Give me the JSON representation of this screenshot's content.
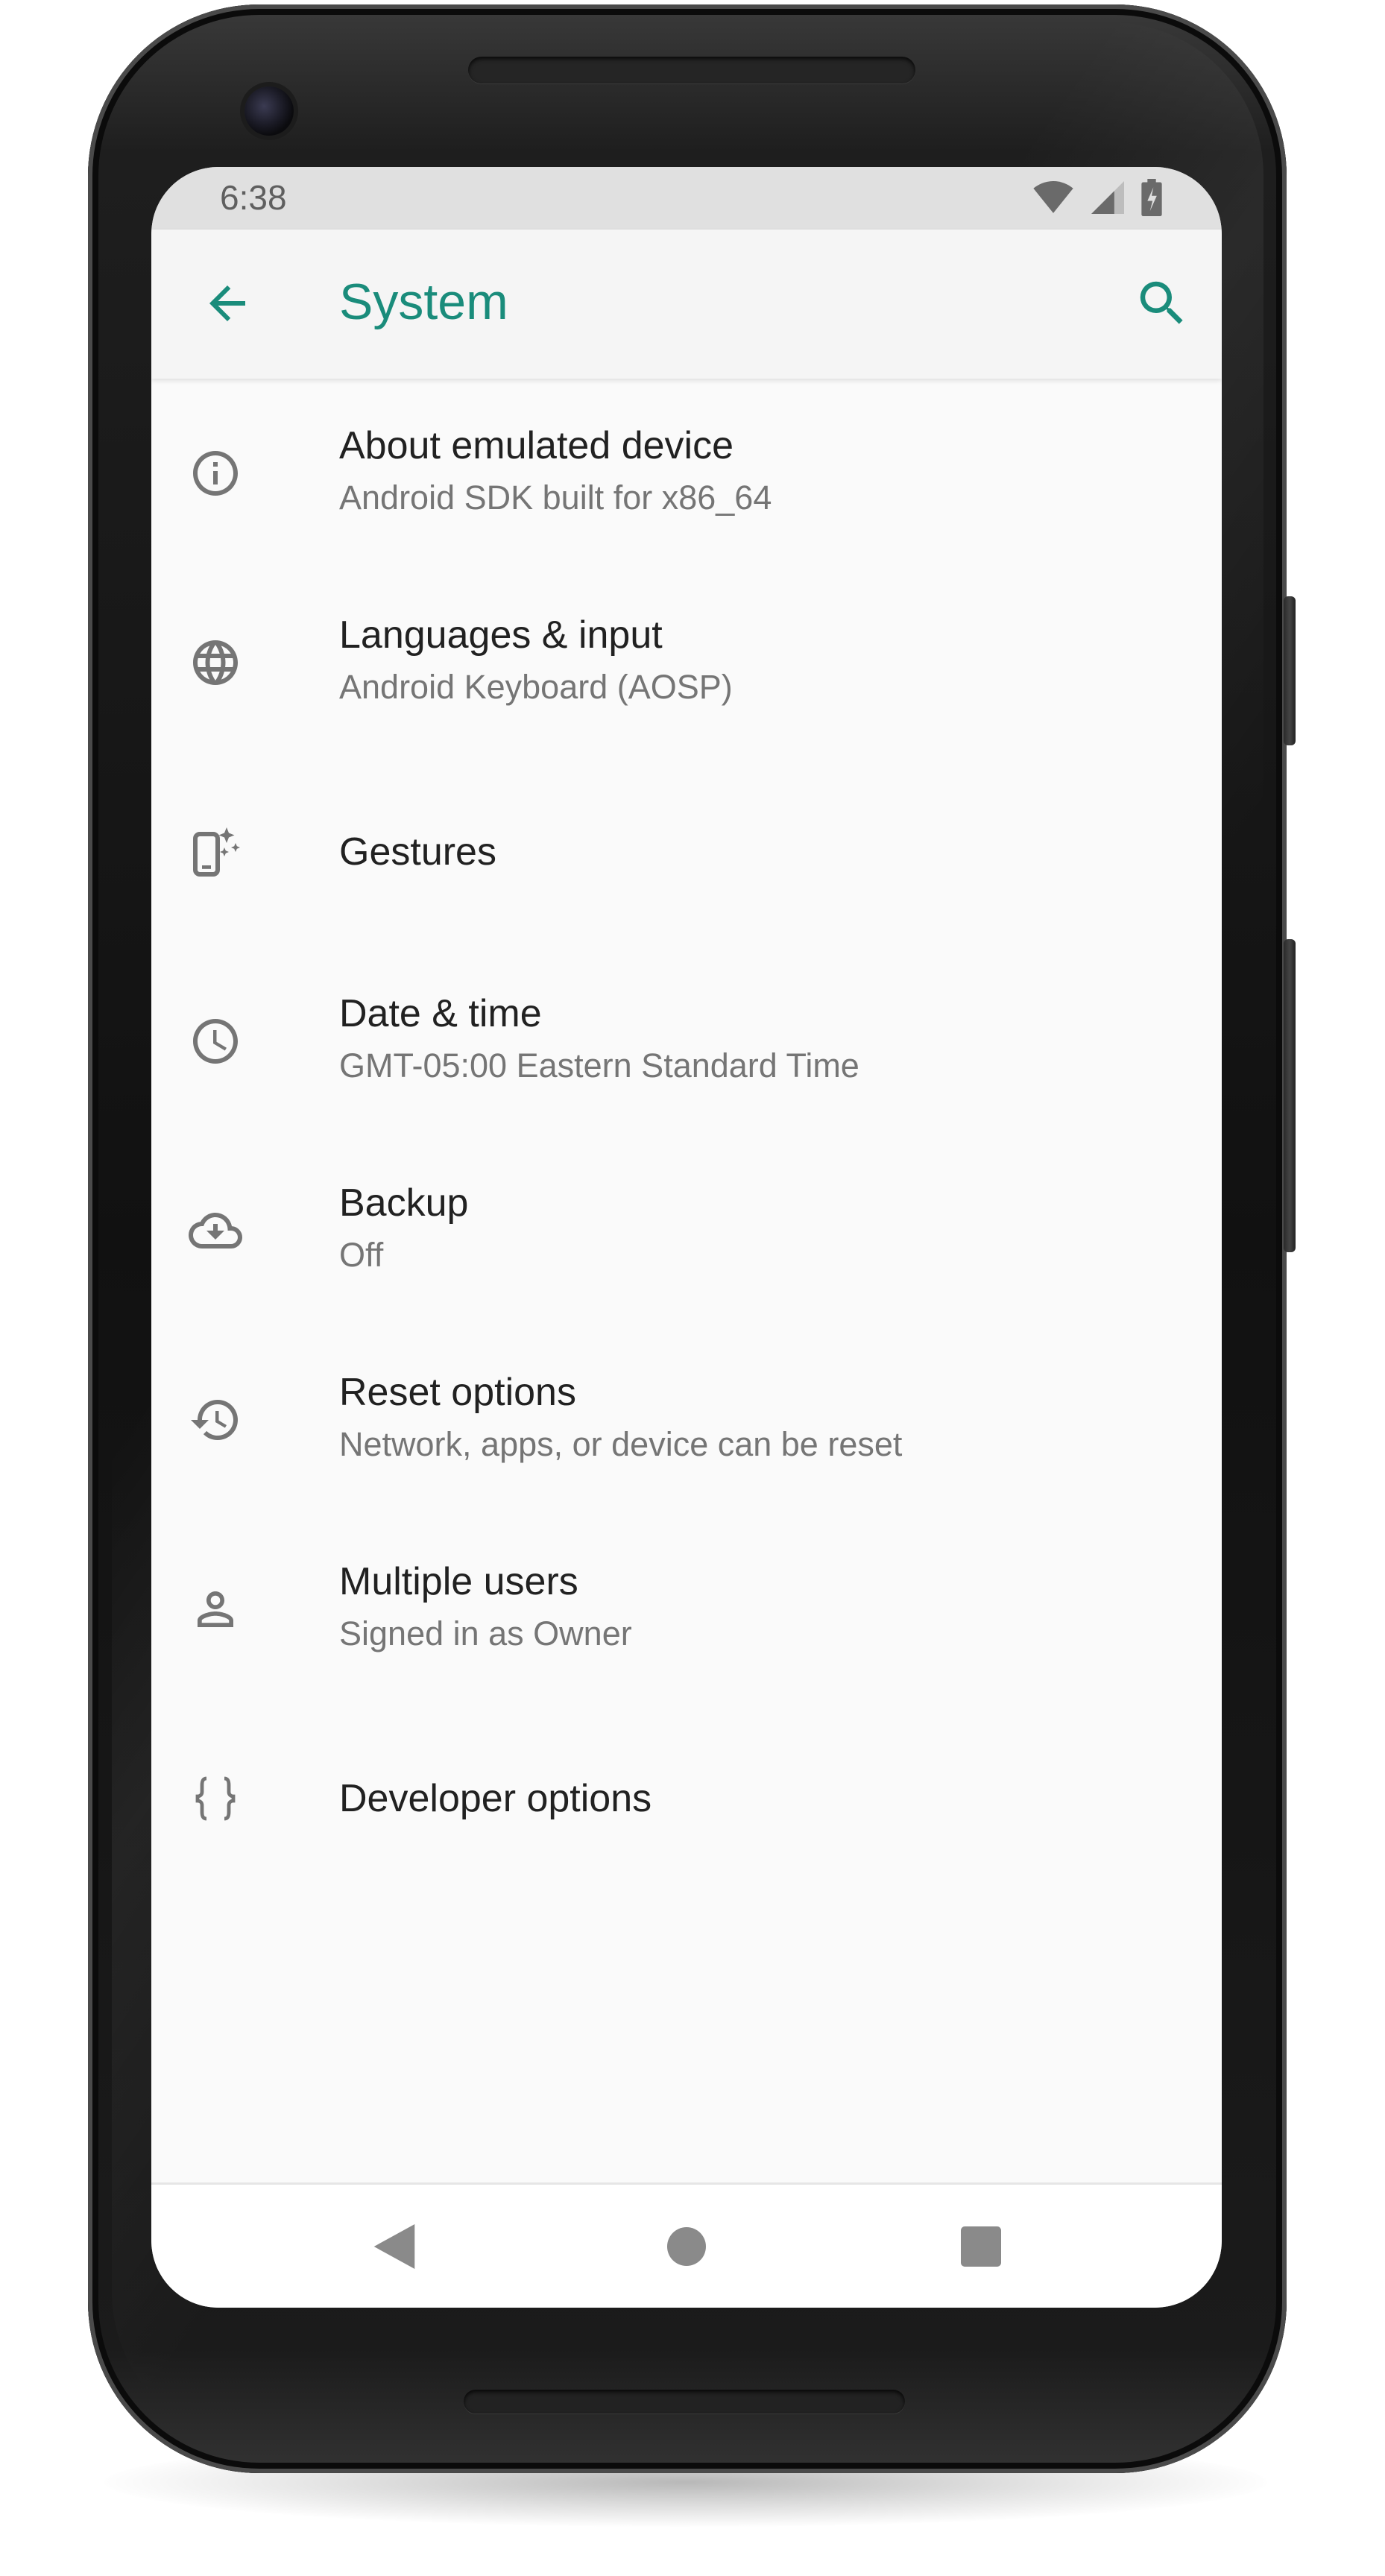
{
  "status_bar": {
    "time": "6:38",
    "icons": [
      "wifi-icon",
      "cell-signal-icon",
      "battery-charging-icon"
    ]
  },
  "app_bar": {
    "title": "System",
    "back_icon": "back-arrow-icon",
    "search_icon": "search-icon"
  },
  "colors": {
    "accent": "#1a8c7b",
    "icon_gray": "#757575",
    "title_text": "#212121",
    "subtitle_text": "#757575",
    "background": "#fafafa",
    "status_bar": "#e0e0e0"
  },
  "settings": [
    {
      "icon": "info-icon",
      "title": "About emulated device",
      "subtitle": "Android SDK built for x86_64"
    },
    {
      "icon": "globe-icon",
      "title": "Languages & input",
      "subtitle": "Android Keyboard (AOSP)"
    },
    {
      "icon": "gestures-phone-icon",
      "title": "Gestures",
      "subtitle": ""
    },
    {
      "icon": "clock-icon",
      "title": "Date & time",
      "subtitle": "GMT-05:00 Eastern Standard Time"
    },
    {
      "icon": "cloud-backup-icon",
      "title": "Backup",
      "subtitle": "Off"
    },
    {
      "icon": "history-reset-icon",
      "title": "Reset options",
      "subtitle": "Network, apps, or device can be reset"
    },
    {
      "icon": "person-icon",
      "title": "Multiple users",
      "subtitle": "Signed in as Owner"
    },
    {
      "icon": "braces-icon",
      "title": "Developer options",
      "subtitle": ""
    }
  ],
  "nav_bar": {
    "icons": [
      "nav-back-icon",
      "nav-home-icon",
      "nav-recents-icon"
    ]
  }
}
